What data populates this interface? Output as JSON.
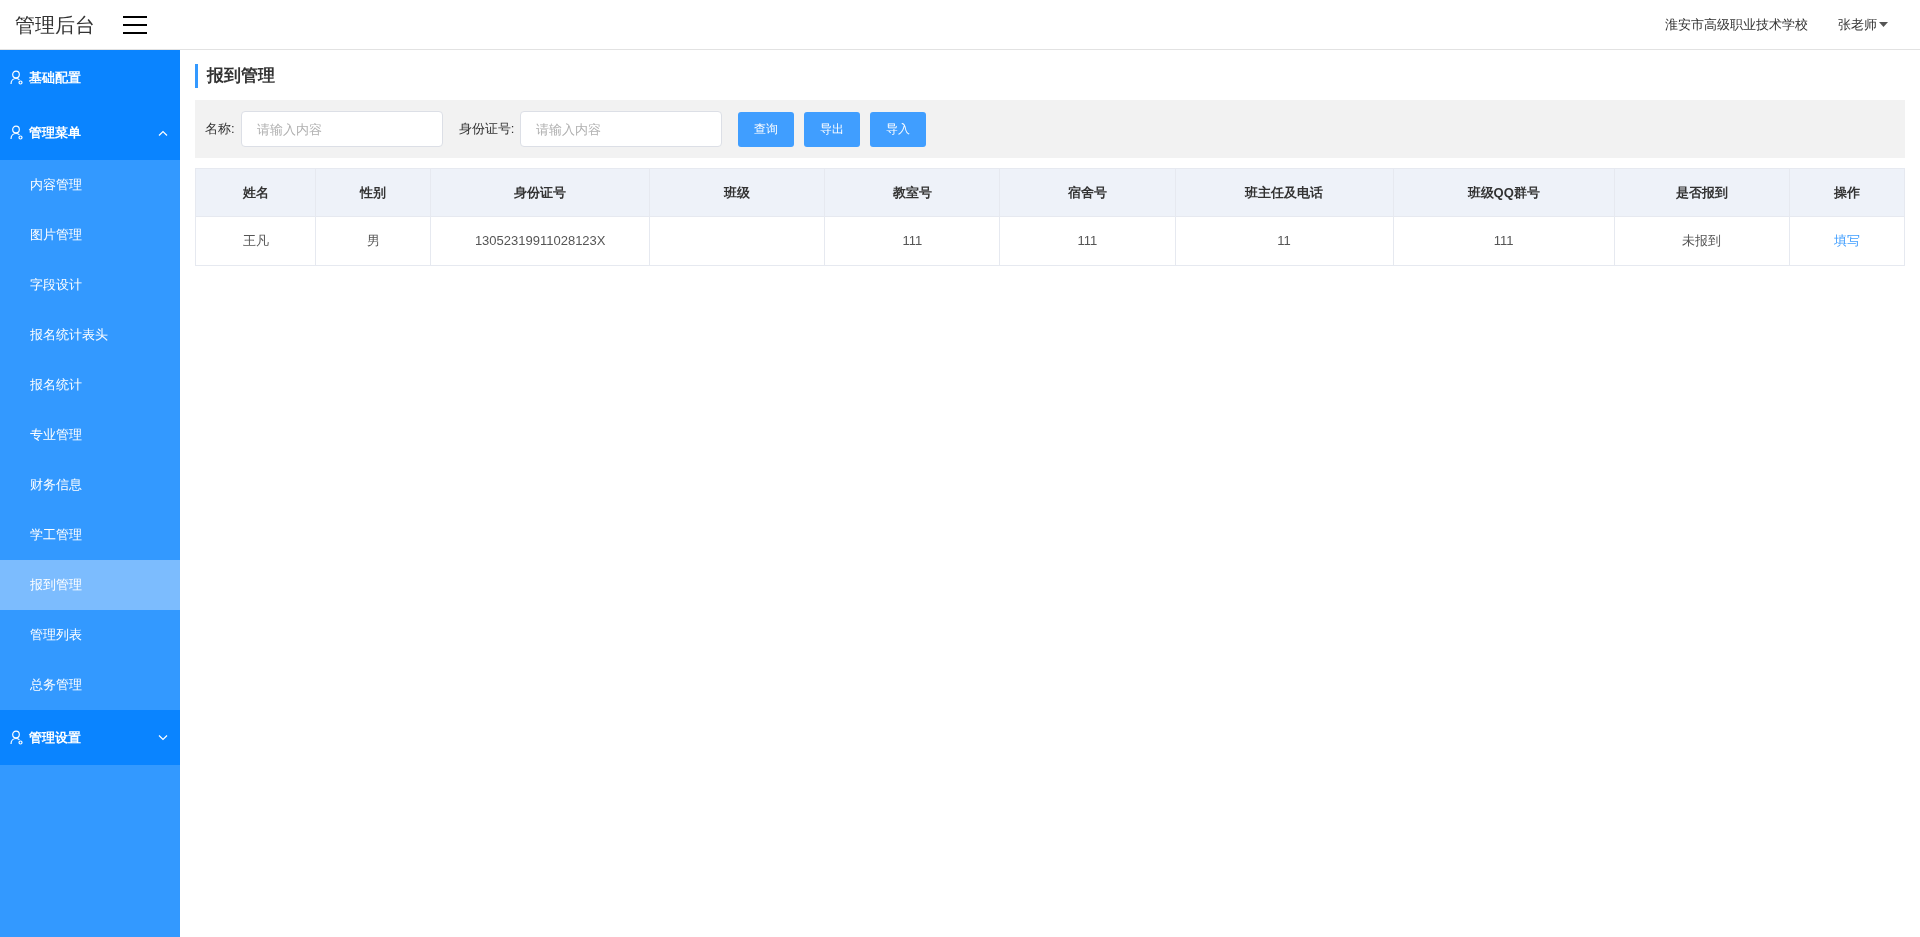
{
  "header": {
    "logo": "管理后台",
    "school": "淮安市高级职业技术学校",
    "user": "张老师"
  },
  "sidebar": {
    "groups": [
      {
        "label": "基础配置"
      },
      {
        "label": "管理菜单",
        "expanded": true,
        "items": [
          {
            "label": "内容管理",
            "selected": false
          },
          {
            "label": "图片管理",
            "selected": false
          },
          {
            "label": "字段设计",
            "selected": false
          },
          {
            "label": "报名统计表头",
            "selected": false
          },
          {
            "label": "报名统计",
            "selected": false
          },
          {
            "label": "专业管理",
            "selected": false
          },
          {
            "label": "财务信息",
            "selected": false
          },
          {
            "label": "学工管理",
            "selected": false
          },
          {
            "label": "报到管理",
            "selected": true
          },
          {
            "label": "管理列表",
            "selected": false
          },
          {
            "label": "总务管理",
            "selected": false
          }
        ]
      },
      {
        "label": "管理设置",
        "expanded": false
      }
    ]
  },
  "page_title": "报到管理",
  "filters": [
    {
      "label": "名称:",
      "placeholder": "请输入内容"
    },
    {
      "label": "身份证号:",
      "placeholder": "请输入内容"
    }
  ],
  "buttons": [
    "查询",
    "导出",
    "导入"
  ],
  "table": {
    "columns": [
      "姓名",
      "性别",
      "身份证号",
      "班级",
      "教室号",
      "宿舍号",
      "班主任及电话",
      "班级QQ群号",
      "是否报到",
      "操作"
    ],
    "rows": [
      {
        "cells": [
          "王凡",
          "男",
          "13052319911028123X",
          "",
          "111",
          "111",
          "11",
          "111",
          "未报到"
        ],
        "action": "填写"
      }
    ]
  }
}
